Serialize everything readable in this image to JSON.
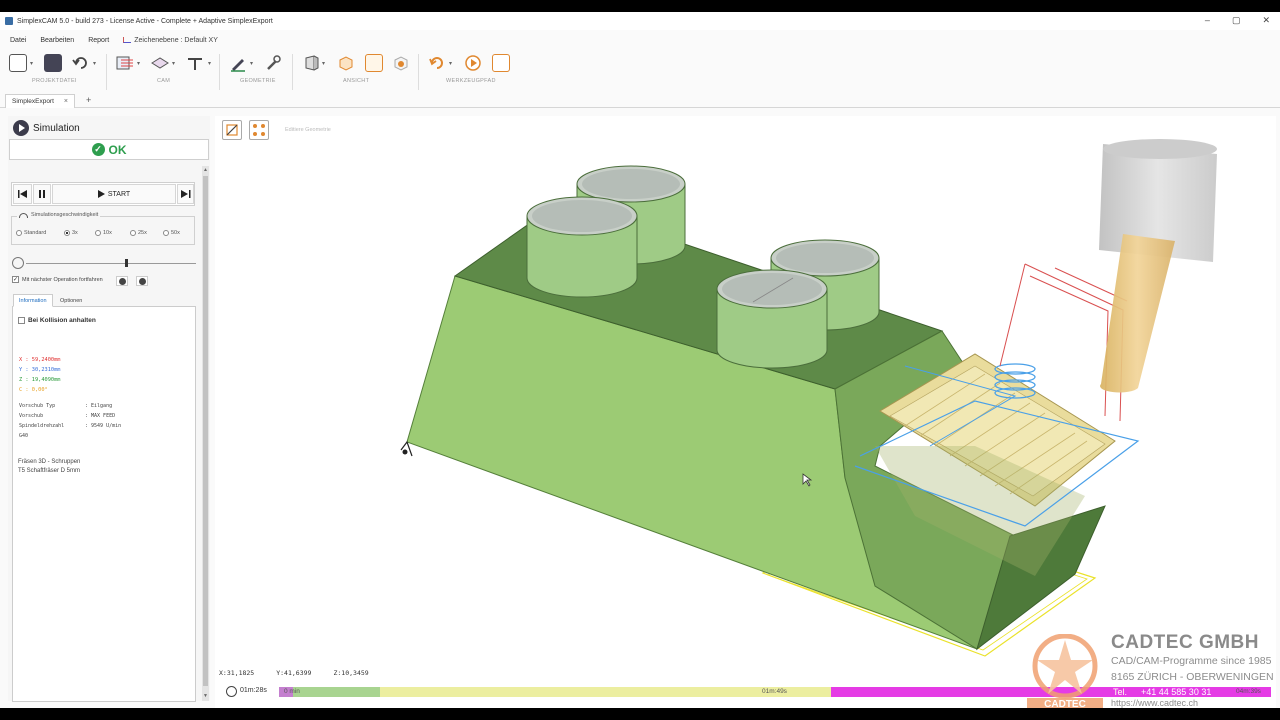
{
  "window": {
    "title": "SimplexCAM 5.0 - build 273 - License Active - Complete + Adaptive SimplexExport",
    "controls": [
      "–",
      "▢",
      "✕"
    ]
  },
  "menu": {
    "items": [
      "Datei",
      "Bearbeiten",
      "Report"
    ],
    "plane": "Zeichenebene : Default XY"
  },
  "ribbon": {
    "groups": [
      "PROJEKTDATEI",
      "CAM",
      "GEOMETRIE",
      "ANSICHT",
      "WERKZEUGPFAD"
    ]
  },
  "tabs": {
    "doc_tab": "SimplexExport",
    "close": "×",
    "add": "+"
  },
  "panel": {
    "title": "Simulation",
    "ok_label": "OK",
    "start_label": "START",
    "speed_legend": "Simulationsgeschwindigkeit",
    "speeds": [
      "Standard",
      "3x",
      "10x",
      "25x",
      "50x"
    ],
    "selected_speed": "3x",
    "continue_label": "Mit nächster Operation fortfahren",
    "info_tabs": [
      "Information",
      "Optionen"
    ],
    "collision_label": "Bei Kollision anhalten",
    "coords": [
      {
        "text": "X : 59,2400mm",
        "color": "#e03030"
      },
      {
        "text": "Y : 30,2310mm",
        "color": "#3a6fd8"
      },
      {
        "text": "Z : 19,4090mm",
        "color": "#2a9a3a"
      },
      {
        "text": "C : 0,00°",
        "color": "#e8a020"
      }
    ],
    "params": [
      {
        "key": "Vorschub Typ",
        "value": ": Eilgang"
      },
      {
        "key": "Vorschub",
        "value": ": MAX FEED"
      },
      {
        "key": "Spindeldrehzahl",
        "value": ": 9549 U/min"
      },
      {
        "key": "G40",
        "value": ""
      }
    ],
    "operation": [
      "Fräsen 3D - Schruppen",
      "T5 Schaftfräser D 5mm"
    ]
  },
  "viewport": {
    "edit_geometry": "Editiere Geometrie",
    "coords": [
      "X:31,1825",
      "Y:41,6399",
      "Z:10,3459"
    ]
  },
  "timeline": {
    "elapsed": "01m:28s",
    "start_label": "0 min",
    "mid_label": "01m:49s",
    "end_label": "04m:39s",
    "colors": [
      "#c47fcf",
      "#a8d490",
      "#eceea0",
      "#f3d88a",
      "#e53be5"
    ]
  },
  "watermark": {
    "name": "CADTEC GMBH",
    "line1": "CAD/CAM-Programme since 1985",
    "line2": "8165 ZÜRICH - OBERWENINGEN",
    "tel_label": "Tel.",
    "tel": "+41 44 585 30 31",
    "web": "https://www.cadtec.ch",
    "logo_text": "CADTEC",
    "brand_color": "#f0a070"
  }
}
